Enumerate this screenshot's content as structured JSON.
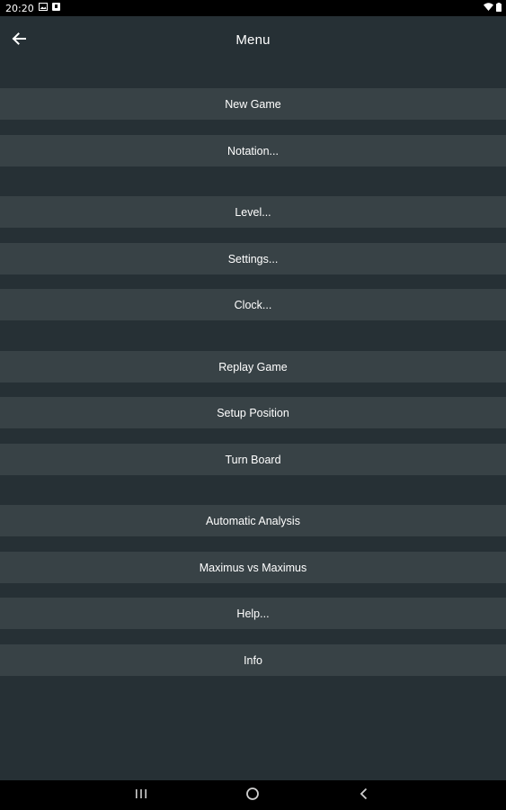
{
  "status_bar": {
    "time": "20:20",
    "left_icons": [
      "image-icon",
      "notification-icon"
    ],
    "right_icons": [
      "wifi-icon",
      "battery-icon"
    ]
  },
  "toolbar": {
    "title": "Menu",
    "back_icon": "arrow-left-icon"
  },
  "menu": {
    "items": [
      {
        "label": "New Game"
      },
      {
        "label": "Notation..."
      },
      {
        "label": "Level..."
      },
      {
        "label": "Settings..."
      },
      {
        "label": "Clock..."
      },
      {
        "label": "Replay Game"
      },
      {
        "label": "Setup Position"
      },
      {
        "label": "Turn Board"
      },
      {
        "label": "Automatic Analysis"
      },
      {
        "label": "Maximus vs Maximus"
      },
      {
        "label": "Help..."
      },
      {
        "label": "Info"
      }
    ]
  },
  "nav_bar": {
    "icons": [
      "recent-apps-icon",
      "home-icon",
      "back-icon"
    ]
  },
  "colors": {
    "background": "#263035",
    "menu_item": "#384246",
    "text": "#ffffff",
    "system_bar": "#000000"
  }
}
